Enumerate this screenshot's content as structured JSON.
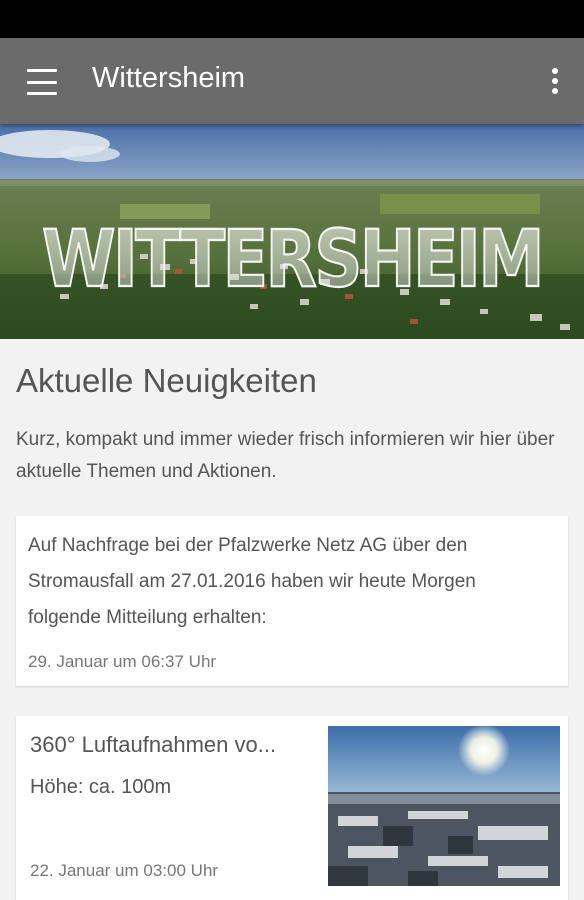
{
  "app_bar": {
    "title": "Wittersheim",
    "menu_icon": "hamburger-menu-icon",
    "overflow_icon": "more-vert-icon",
    "background": "#6b6b6b"
  },
  "hero": {
    "logo_text": "WITTERSHEIM"
  },
  "section": {
    "title": "Aktuelle Neuigkeiten",
    "description": "Kurz, kompakt und immer wieder frisch informieren wir hier über aktuelle Themen und Aktionen."
  },
  "news": [
    {
      "text": "Auf Nachfrage bei der Pfalzwerke Netz AG über den Stromausfall am 27.01.2016 haben wir heute Morgen folgende Mitteilung erhalten:",
      "date": "29. Januar um 06:37 Uhr"
    },
    {
      "title": "360° Luftaufnahmen vo...",
      "subtitle": "Höhe: ca. 100m",
      "date": "22. Januar um 03:00 Uhr"
    }
  ]
}
